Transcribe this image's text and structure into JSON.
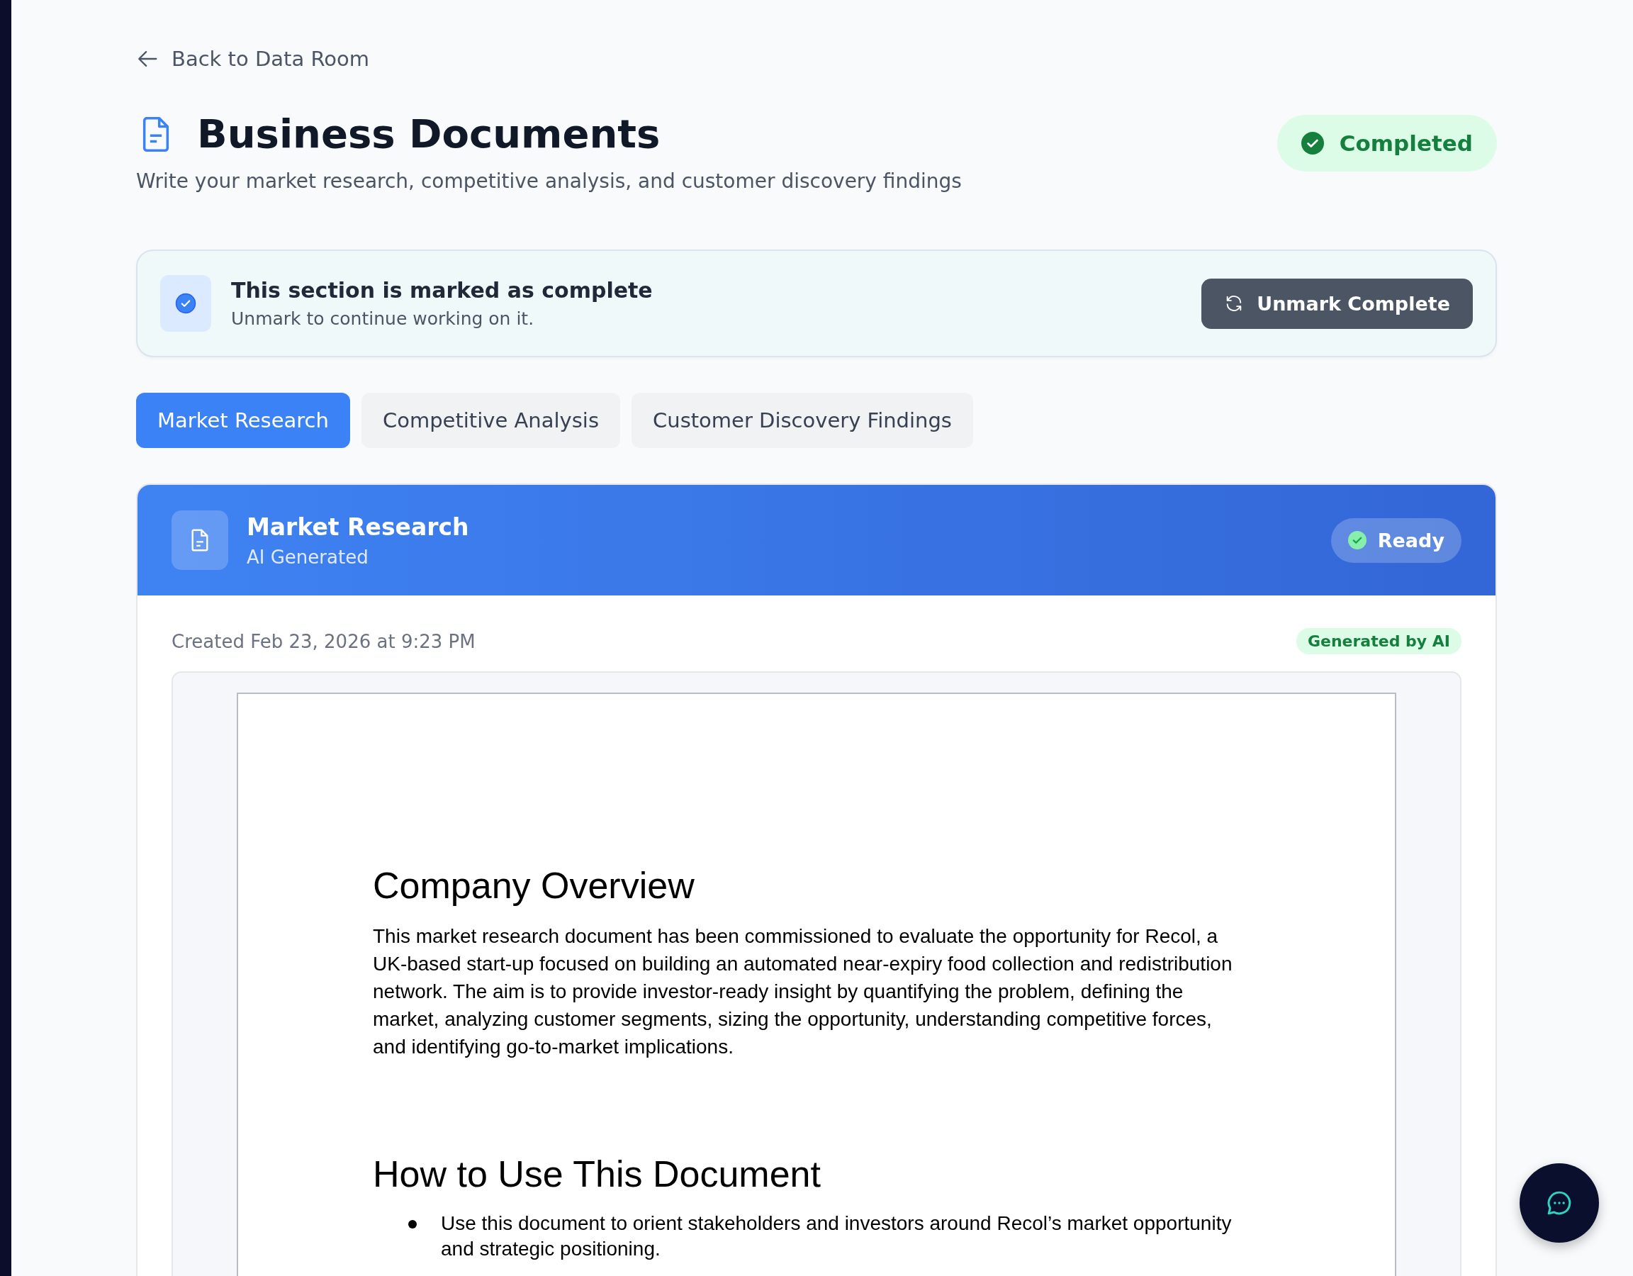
{
  "back_link": "Back to Data Room",
  "header": {
    "title": "Business Documents",
    "subtitle": "Write your market research, competitive analysis, and customer discovery findings",
    "status": {
      "label": "Completed",
      "kind": "completed"
    }
  },
  "completion_banner": {
    "checked": true,
    "title": "This section is marked as complete",
    "description": "Unmark to continue working on it.",
    "button": "Unmark Complete"
  },
  "tabs": [
    {
      "label": "Market Research",
      "selected": true
    },
    {
      "label": "Competitive Analysis",
      "selected": false
    },
    {
      "label": "Customer Discovery Findings",
      "selected": false
    }
  ],
  "document_card": {
    "title": "Market Research",
    "subtitle": "AI Generated",
    "status": "Ready",
    "created": "Created Feb 23, 2026 at 9:23 PM",
    "badge": "Generated by AI",
    "sections": [
      {
        "heading": "Company Overview",
        "paragraph": "This market research document has been commissioned to evaluate the opportunity for Recol, a UK-based start-up focused on building an automated near-expiry food collection and redistribution network. The aim is to provide investor-ready insight by quantifying the problem, defining the market, analyzing customer segments, sizing the opportunity, understanding competitive forces, and identifying go-to-market implications."
      },
      {
        "heading": "How to Use This Document",
        "bullets": [
          "Use this document to orient stakeholders and investors around Recol’s market opportunity and strategic positioning."
        ]
      }
    ]
  }
}
